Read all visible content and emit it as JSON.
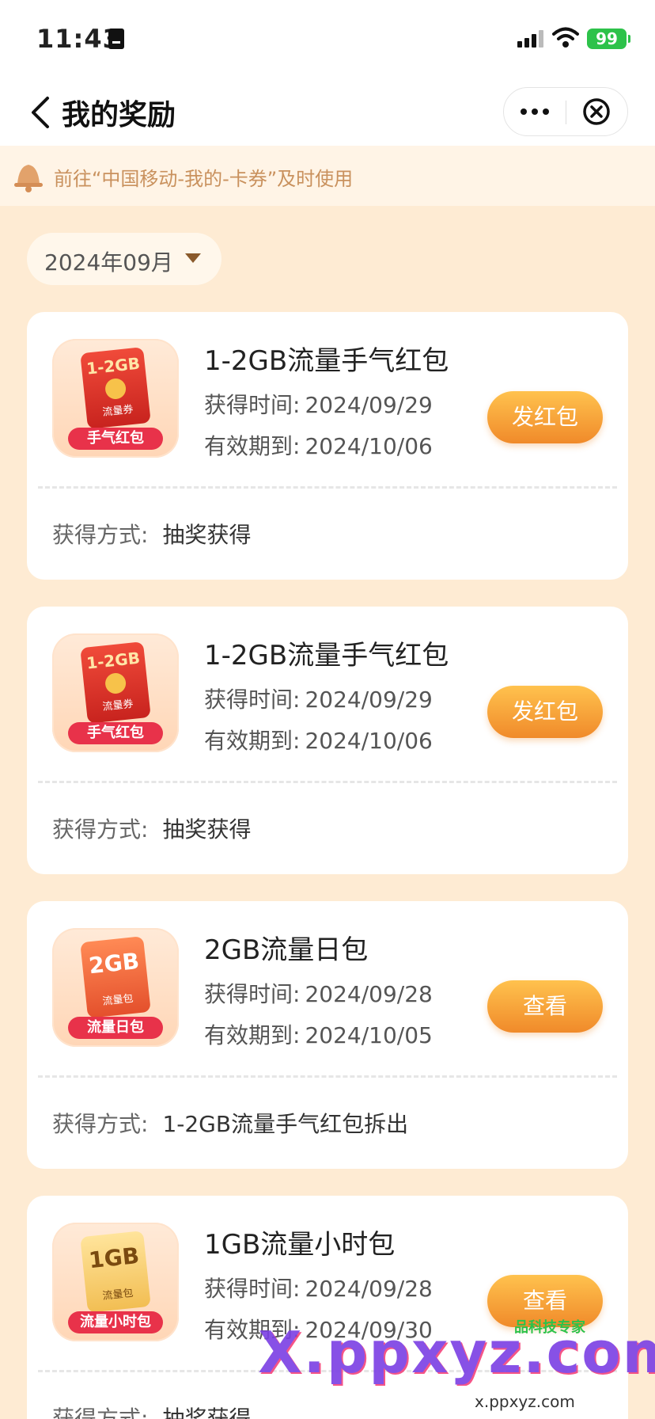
{
  "status_bar": {
    "time": "11:43",
    "battery": "99"
  },
  "nav": {
    "title": "我的奖励"
  },
  "notice": {
    "text": "前往“中国移动-我的-卡券”及时使用"
  },
  "month_picker": {
    "label": "2024年09月"
  },
  "labels": {
    "obtained_time": "获得时间:",
    "valid_until": "有效期到:",
    "method": "获得方式:"
  },
  "rewards": [
    {
      "title": "1-2GB流量手气红包",
      "obtained": "2024/09/29",
      "valid_until": "2024/10/06",
      "action": "发红包",
      "method": "抽奖获得",
      "thumb": {
        "top": "1-2GB",
        "sub": "流量券",
        "badge": "手气红包"
      }
    },
    {
      "title": "1-2GB流量手气红包",
      "obtained": "2024/09/29",
      "valid_until": "2024/10/06",
      "action": "发红包",
      "method": "抽奖获得",
      "thumb": {
        "top": "1-2GB",
        "sub": "流量券",
        "badge": "手气红包"
      }
    },
    {
      "title": "2GB流量日包",
      "obtained": "2024/09/28",
      "valid_until": "2024/10/05",
      "action": "查看",
      "method": "1-2GB流量手气红包拆出",
      "thumb": {
        "top": "2GB",
        "sub": "流量包",
        "badge": "流量日包"
      }
    },
    {
      "title": "1GB流量小时包",
      "obtained": "2024/09/28",
      "valid_until": "2024/09/30",
      "action": "查看",
      "method": "抽奖获得",
      "thumb": {
        "top": "1GB",
        "sub": "流量包",
        "badge": "流量小时包"
      }
    }
  ],
  "watermark": {
    "main": "X.ppxyz.com",
    "sub": "x.ppxyz.com",
    "logo": "品科技专家"
  }
}
